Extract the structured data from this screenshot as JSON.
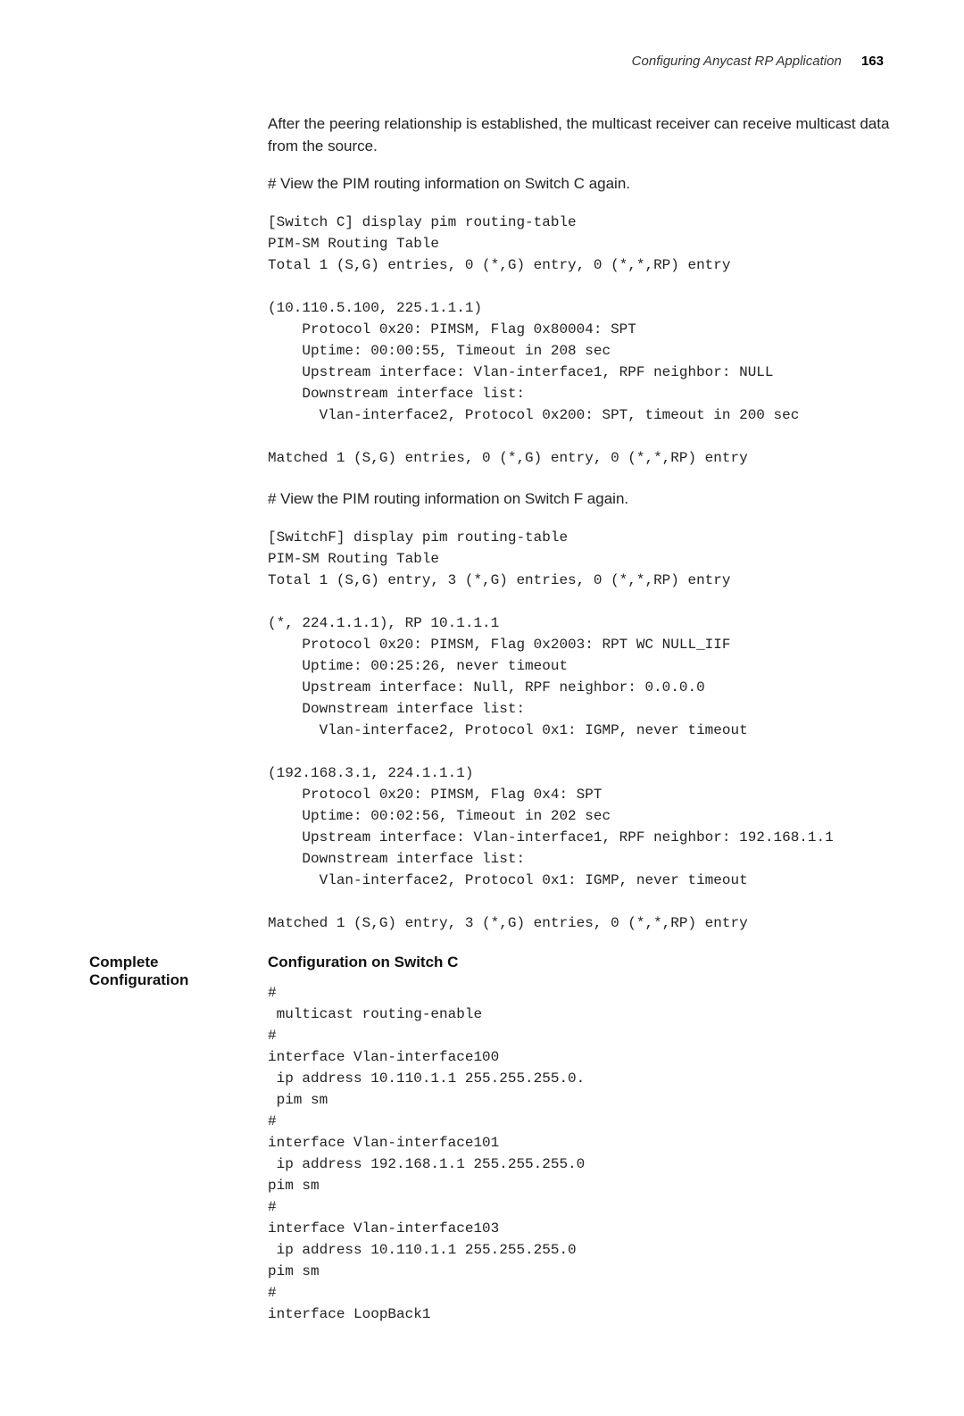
{
  "header": {
    "section_title": "Configuring Anycast RP Application",
    "page_number": "163"
  },
  "content": {
    "intro_para": "After the peering relationship is established, the multicast receiver can receive multicast data from the source.",
    "view_c_para": "# View the PIM routing information on Switch C again.",
    "terminal_c": "[Switch C] display pim routing-table\nPIM-SM Routing Table\nTotal 1 (S,G) entries, 0 (*,G) entry, 0 (*,*,RP) entry\n\n(10.110.5.100, 225.1.1.1)\n    Protocol 0x20: PIMSM, Flag 0x80004: SPT\n    Uptime: 00:00:55, Timeout in 208 sec\n    Upstream interface: Vlan-interface1, RPF neighbor: NULL\n    Downstream interface list:\n      Vlan-interface2, Protocol 0x200: SPT, timeout in 200 sec\n\nMatched 1 (S,G) entries, 0 (*,G) entry, 0 (*,*,RP) entry",
    "view_f_para": "# View the PIM routing information on Switch F again.",
    "terminal_f": "[SwitchF] display pim routing-table\nPIM-SM Routing Table\nTotal 1 (S,G) entry, 3 (*,G) entries, 0 (*,*,RP) entry\n\n(*, 224.1.1.1), RP 10.1.1.1\n    Protocol 0x20: PIMSM, Flag 0x2003: RPT WC NULL_IIF\n    Uptime: 00:25:26, never timeout\n    Upstream interface: Null, RPF neighbor: 0.0.0.0\n    Downstream interface list:\n      Vlan-interface2, Protocol 0x1: IGMP, never timeout\n\n(192.168.3.1, 224.1.1.1)\n    Protocol 0x20: PIMSM, Flag 0x4: SPT\n    Uptime: 00:02:56, Timeout in 202 sec\n    Upstream interface: Vlan-interface1, RPF neighbor: 192.168.1.1\n    Downstream interface list:\n      Vlan-interface2, Protocol 0x1: IGMP, never timeout\n\nMatched 1 (S,G) entry, 3 (*,G) entries, 0 (*,*,RP) entry",
    "side_heading": "Complete Configuration",
    "subsection_heading": "Configuration on Switch C",
    "config_c": "#\n multicast routing-enable\n#\ninterface Vlan-interface100\n ip address 10.110.1.1 255.255.255.0.\n pim sm\n#\ninterface Vlan-interface101\n ip address 192.168.1.1 255.255.255.0\npim sm\n#\ninterface Vlan-interface103\n ip address 10.110.1.1 255.255.255.0\npim sm\n#\ninterface LoopBack1"
  }
}
